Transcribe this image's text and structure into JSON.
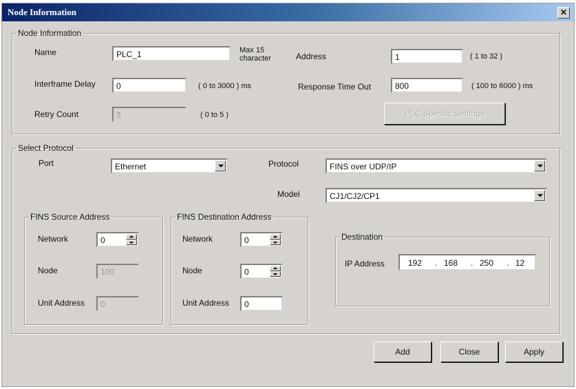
{
  "window": {
    "title": "Node Information",
    "close": "✕"
  },
  "node_info": {
    "legend": "Node Information",
    "name_label": "Name",
    "name_value": "PLC_1",
    "name_hint": "Max 15\ncharacter",
    "address_label": "Address",
    "address_value": "1",
    "address_hint": "( 1 to 32 )",
    "interframe_label": "Interframe Delay",
    "interframe_value": "0",
    "interframe_hint": "( 0 to 3000 ) ms",
    "response_label": "Response Time Out",
    "response_value": "800",
    "response_hint": "( 100 to 6000 ) ms",
    "retry_label": "Retry Count",
    "retry_value": "3",
    "retry_hint": "( 0 to 5 )",
    "plc_button": "PLC Specific Settings"
  },
  "protocol": {
    "legend": "Select Protocol",
    "port_label": "Port",
    "port_value": "Ethernet",
    "protocol_label": "Protocol",
    "protocol_value": "FINS over UDP/IP",
    "model_label": "Model",
    "model_value": "CJ1/CJ2/CP1"
  },
  "fins_source": {
    "legend": "FINS Source Address",
    "network_label": "Network",
    "network_value": "0",
    "node_label": "Node",
    "node_value": "100",
    "unit_label": "Unit Address",
    "unit_value": "0"
  },
  "fins_dest": {
    "legend": "FINS Destination Address",
    "network_label": "Network",
    "network_value": "0",
    "node_label": "Node",
    "node_value": "0",
    "unit_label": "Unit Address",
    "unit_value": "0"
  },
  "destination": {
    "legend": "Destination",
    "ip_label": "IP Address",
    "ip": {
      "o1": "192",
      "o2": "168",
      "o3": "250",
      "o4": "12",
      "dot": "."
    }
  },
  "buttons": {
    "add": "Add",
    "close": "Close",
    "apply": "Apply"
  }
}
